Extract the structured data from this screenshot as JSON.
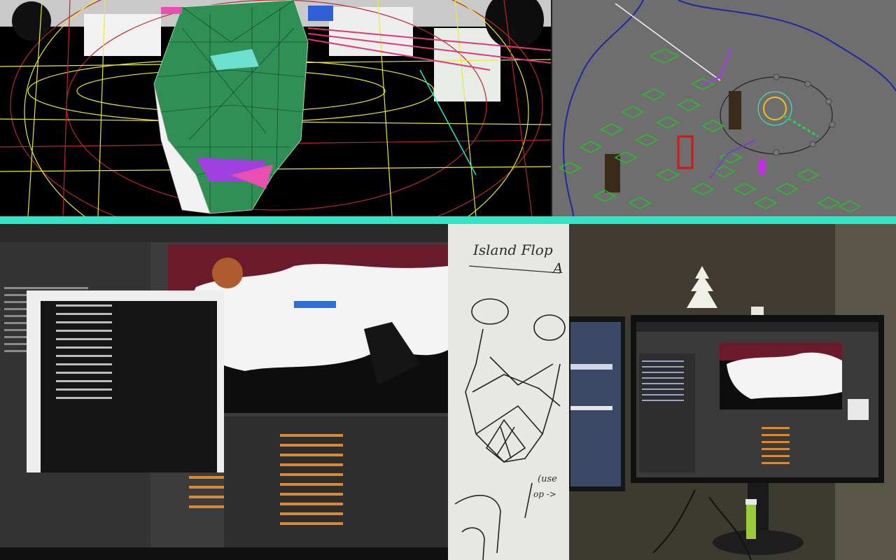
{
  "colors": {
    "separator_teal": "#2ee6c8",
    "wire_yellow": "#e8e83a",
    "wire_red": "#b8282a",
    "mesh_green": "#2f8f55",
    "scene_green": "#1fc81f",
    "viewport_grey": "#6e6e6e",
    "timeline_orange": "#d98a34"
  },
  "photo_panels": [
    {
      "name": "3d-wireframe-head-viewport",
      "caption": ""
    },
    {
      "name": "top-down-scene-viewport",
      "caption": ""
    },
    {
      "name": "monitor-photo-editor",
      "caption": ""
    },
    {
      "name": "whiteboard-sketch",
      "caption": ""
    },
    {
      "name": "desk-monitors-photo",
      "caption": ""
    }
  ],
  "whiteboard": {
    "title": "Island Flop",
    "title_suffix": "A",
    "note_line1": "(use",
    "note_line2": "op ->"
  }
}
